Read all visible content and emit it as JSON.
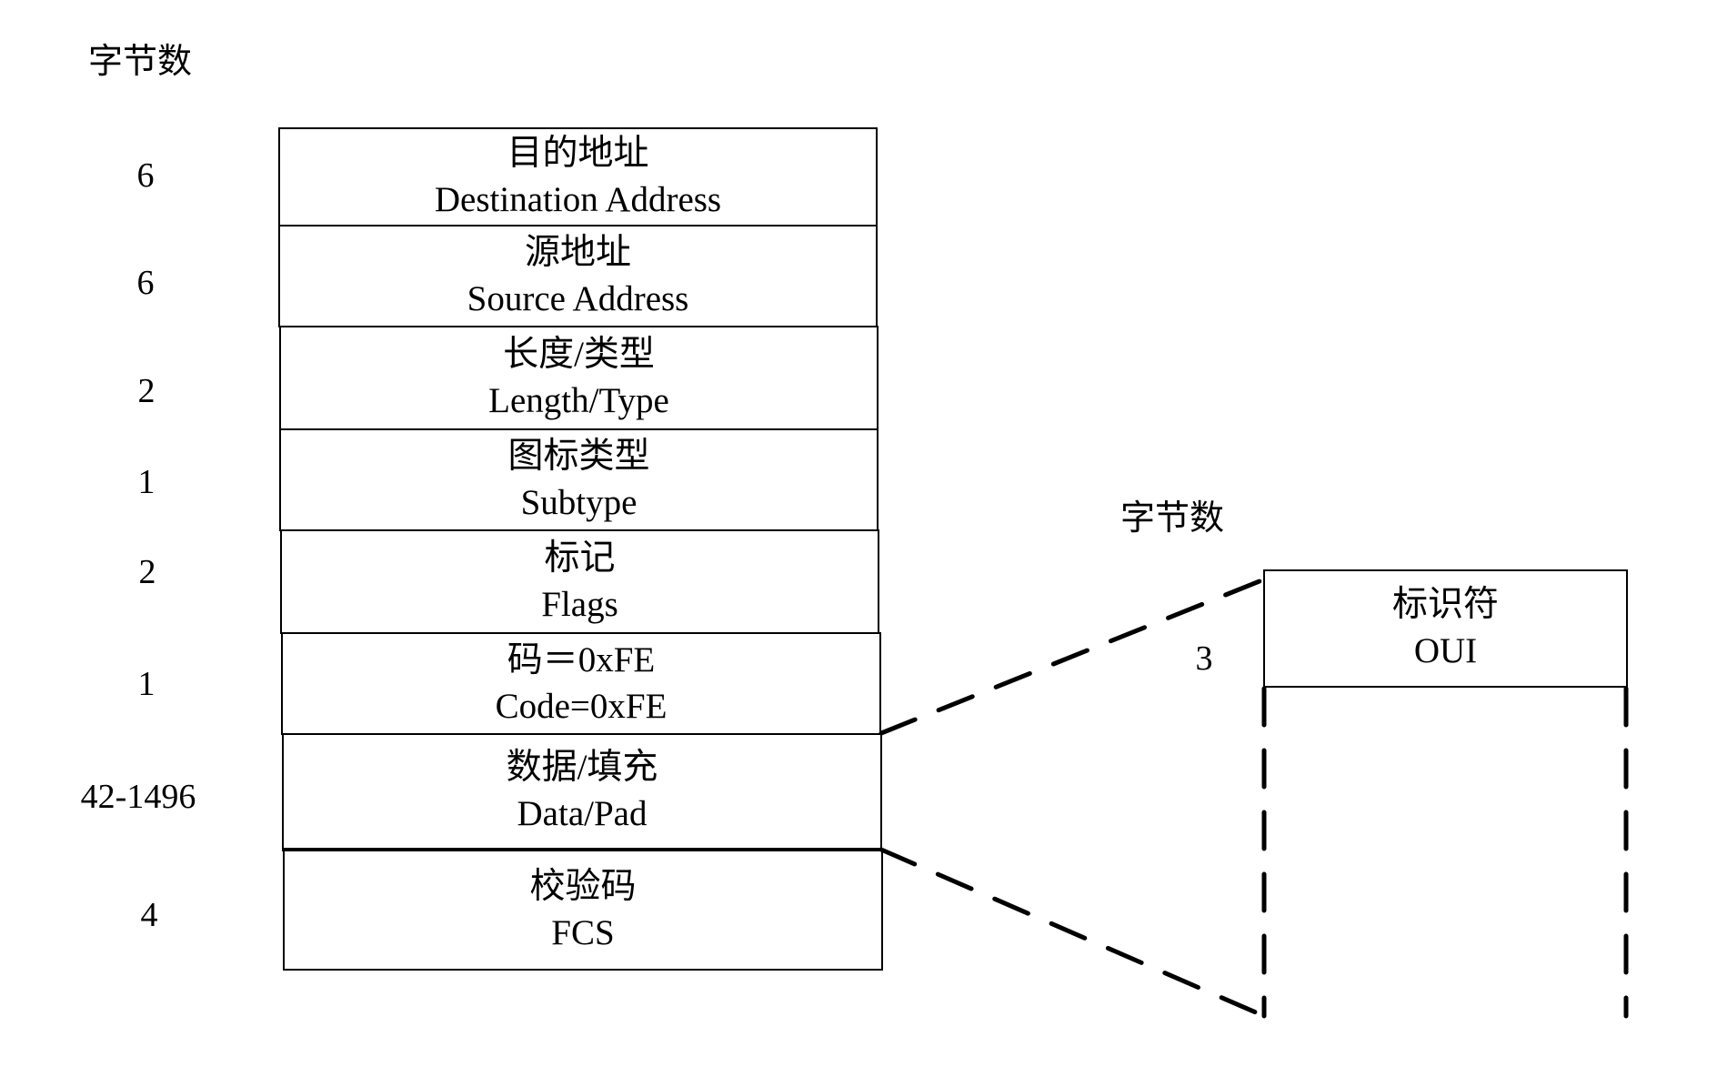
{
  "diagram": {
    "main_frame": {
      "column_header": "字节数",
      "fields": [
        {
          "size": "6",
          "label_zh": "目的地址",
          "label_en": "Destination Address"
        },
        {
          "size": "6",
          "label_zh": "源地址",
          "label_en": "Source Address"
        },
        {
          "size": "2",
          "label_zh": "长度/类型",
          "label_en": "Length/Type"
        },
        {
          "size": "1",
          "label_zh": "图标类型",
          "label_en": "Subtype"
        },
        {
          "size": "2",
          "label_zh": "标记",
          "label_en": "Flags"
        },
        {
          "size": "1",
          "label_zh": "码＝0xFE",
          "label_en": "Code=0xFE"
        },
        {
          "size": "42-1496",
          "label_zh": "数据/填充",
          "label_en": "Data/Pad"
        },
        {
          "size": "4",
          "label_zh": "校验码",
          "label_en": "FCS"
        }
      ]
    },
    "expanded_detail": {
      "column_header": "字节数",
      "expands_field": "Data/Pad",
      "fields": [
        {
          "size": "3",
          "label_zh": "标识符",
          "label_en": "OUI"
        }
      ]
    }
  }
}
